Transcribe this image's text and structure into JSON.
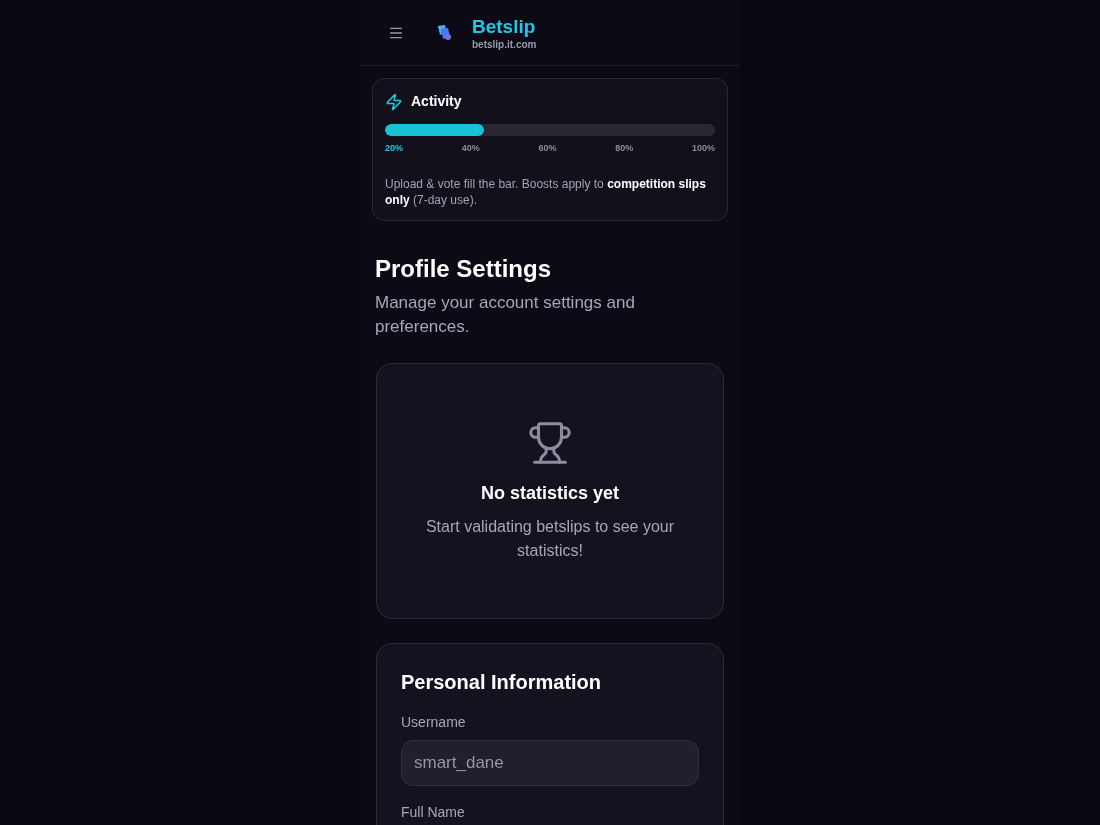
{
  "header": {
    "title": "Betslip",
    "subtitle": "betslip.it.com"
  },
  "activity": {
    "title": "Activity",
    "level": 0.3,
    "ticks": [
      {
        "label": "20%",
        "reached": true
      },
      {
        "label": "40%",
        "reached": false
      },
      {
        "label": "60%",
        "reached": false
      },
      {
        "label": "80%",
        "reached": false
      },
      {
        "label": "100%",
        "reached": false
      }
    ],
    "note": "Upload & vote fill the bar. Boosts apply to **competition slips only** (7-day use)."
  },
  "page": {
    "title": "Profile Settings",
    "subtitle": "Manage your account settings and preferences."
  },
  "statistics": {
    "title": "No statistics yet",
    "message": "Start validating betslips to see your statistics!"
  },
  "personal_information": {
    "title": "Personal Information",
    "fields": [
      {
        "label": "Username",
        "value": "smart_dane",
        "disabled": true
      },
      {
        "label": "Full Name"
      }
    ]
  }
}
